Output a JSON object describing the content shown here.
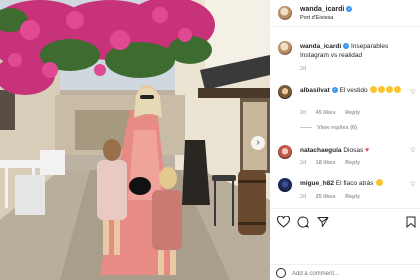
{
  "post": {
    "username": "wanda_icardi",
    "location": "Port d'Eivissa"
  },
  "caption": {
    "username": "wanda_icardi",
    "text": "Inseparables Instagram vs realidad",
    "time": "2d"
  },
  "comments": [
    {
      "username": "albasilvat",
      "text": "El vestido",
      "time": "2d",
      "likes": "45 likes",
      "reply": "Reply",
      "view_replies": "View replies (6)"
    },
    {
      "username": "natachaeguia",
      "text": "Diosas",
      "time": "2d",
      "likes": "18 likes",
      "reply": "Reply"
    },
    {
      "username": "migue_h82",
      "text": "El flaco atrás",
      "time": "2d",
      "likes": "25 likes",
      "reply": "Reply"
    }
  ],
  "add_comment": {
    "placeholder": "Add a comment..."
  },
  "icons": [
    "heart-icon",
    "comment-icon",
    "share-icon",
    "bookmark-icon",
    "smiley-icon",
    "next-arrow-icon",
    "verified-icon"
  ],
  "colors": {
    "verified": "#3897f0",
    "heart_red": "#ed4956",
    "muted_text": "#999999",
    "dress_pink": "#e88b84"
  }
}
